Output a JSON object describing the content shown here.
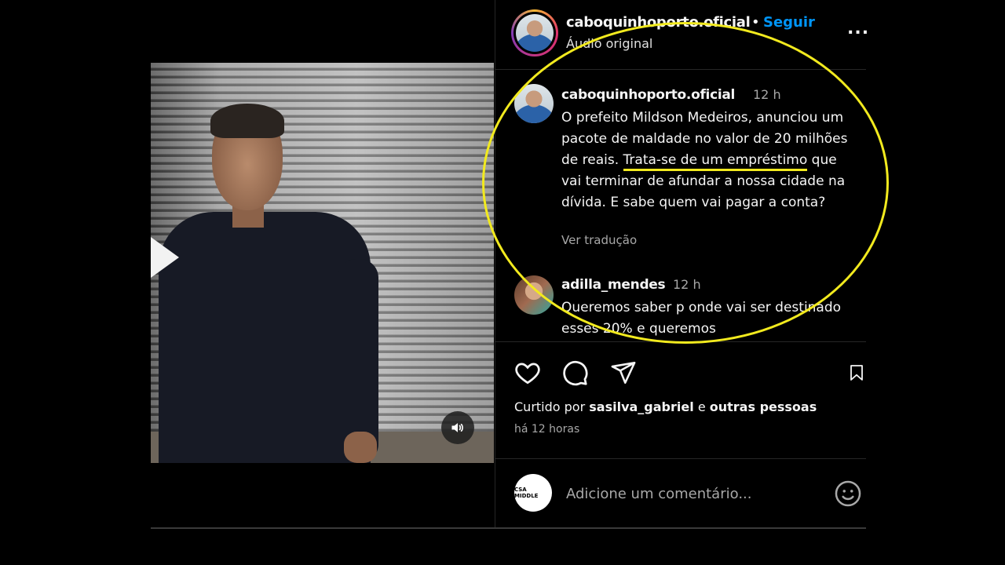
{
  "header": {
    "username": "caboquinhoporto.oficial",
    "separator": "•",
    "follow": "Seguir",
    "subtitle": "Áudio original",
    "more": "..."
  },
  "caption": {
    "username": "caboquinhoporto.oficial",
    "time": "12 h",
    "text_before": "O prefeito Mildson Medeiros, anunciou um pacote de maldade no valor de 20 milhões de reais.",
    "text_underlined": "Trata-se de um empréstimo",
    "text_after": "que vai terminar de afundar a nossa cidade na dívida. E sabe quem vai pagar a conta?",
    "translate": "Ver tradução"
  },
  "comments": [
    {
      "username": "adilla_mendes",
      "time": "12 h",
      "text": "Queremos saber p onde vai ser destinado esses 20% e queremos"
    }
  ],
  "actions": {
    "icons": [
      "heart-icon",
      "comment-icon",
      "share-icon",
      "bookmark-icon"
    ]
  },
  "likes": {
    "prefix": "Curtido por",
    "user": "sasilva_gabriel",
    "conj": "e",
    "others": "outras pessoas"
  },
  "post_time": "há 12 horas",
  "add_comment": {
    "placeholder": "Adicione um comentário...",
    "avatar_text": "CSA MIDDLE"
  },
  "colors": {
    "accent": "#0095f6",
    "annotation": "#f2ea1e",
    "background": "#000000"
  }
}
